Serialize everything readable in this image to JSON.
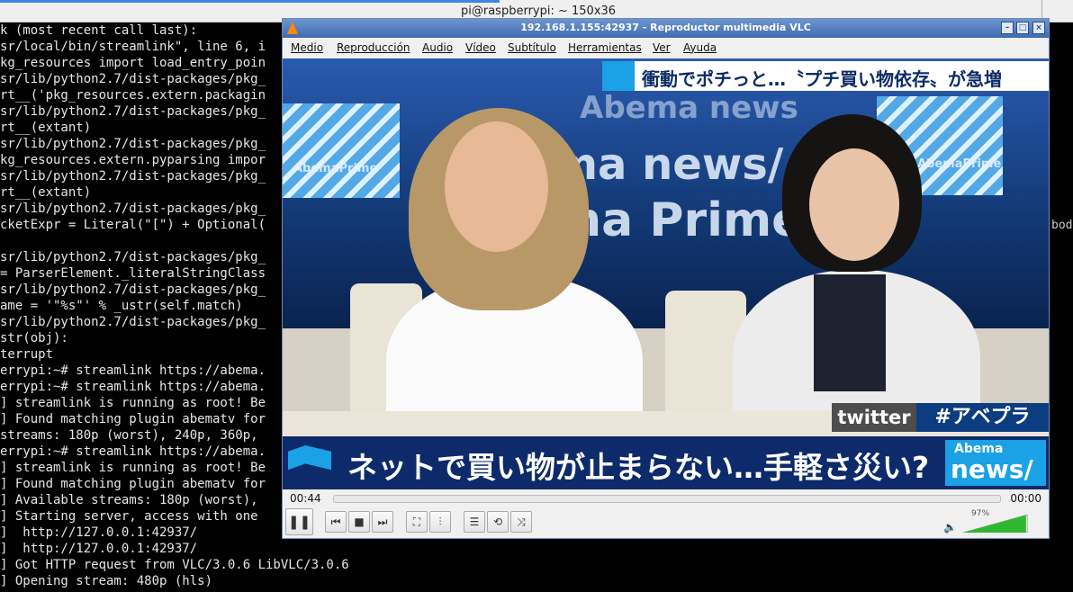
{
  "terminal": {
    "title": "pi@raspberrypi: ~ 150x36",
    "lines": [
      "k (most recent call last):",
      "sr/local/bin/streamlink\", line 6, i",
      "kg_resources import load_entry_poin",
      "sr/lib/python2.7/dist-packages/pkg_",
      "rt__('pkg_resources.extern.packagin",
      "sr/lib/python2.7/dist-packages/pkg_",
      "rt__(extant)",
      "sr/lib/python2.7/dist-packages/pkg_",
      "kg_resources.extern.pyparsing impor",
      "sr/lib/python2.7/dist-packages/pkg_",
      "rt__(extant)",
      "sr/lib/python2.7/dist-packages/pkg_",
      "cketExpr = Literal(\"[\") + Optional(",
      "",
      "sr/lib/python2.7/dist-packages/pkg_",
      "= ParserElement._literalStringClass",
      "sr/lib/python2.7/dist-packages/pkg_",
      "ame = '\"%s\"' % _ustr(self.match)",
      "sr/lib/python2.7/dist-packages/pkg_",
      "str(obj):",
      "terrupt",
      "errypi:~# streamlink https://abema.",
      "errypi:~# streamlink https://abema.",
      "] streamlink is running as root! Be",
      "] Found matching plugin abematv for",
      "streams: 180p (worst), 240p, 360p, ",
      "errypi:~# streamlink https://abema.",
      "] streamlink is running as root! Be",
      "] Found matching plugin abematv for",
      "] Available streams: 180p (worst), ",
      "] Starting server, access with one ",
      "]  http://127.0.0.1:42937/",
      "]  http://127.0.0.1:42937/",
      "] Got HTTP request from VLC/3.0.6 LibVLC/3.0.6",
      "] Opening stream: 480p (hls)"
    ],
    "right_fragment": "bod"
  },
  "vlc": {
    "title": "192.168.1.155:42937 - Reproductor multimedia VLC",
    "menu": [
      "Medio",
      "Reproducción",
      "Audio",
      "Vídeo",
      "Subtítulo",
      "Herramientas",
      "Ver",
      "Ayuda"
    ],
    "time_elapsed": "00:44",
    "time_total": "00:00",
    "volume_label": "97%",
    "volume_level": 0.97,
    "colors": {
      "titlebar": "#3f6bb0",
      "volume_fill": "#2fb82f"
    }
  },
  "video": {
    "top_banner": "衝動でポチっと…〝プチ買い物依存〟が急増",
    "twitter_label": "twitter",
    "hashtag": "#アベプラ",
    "lower_third": "ネットで買い物が止まらない…手軽さ災い?",
    "logo_line1": "Abema",
    "logo_line2": "news/",
    "set_text_1": "AbemaPrime",
    "set_text_2": "AbemaPrime",
    "set_text_3": "ma news/",
    "set_text_4": "ma Prime",
    "set_text_5": "Abema news"
  }
}
